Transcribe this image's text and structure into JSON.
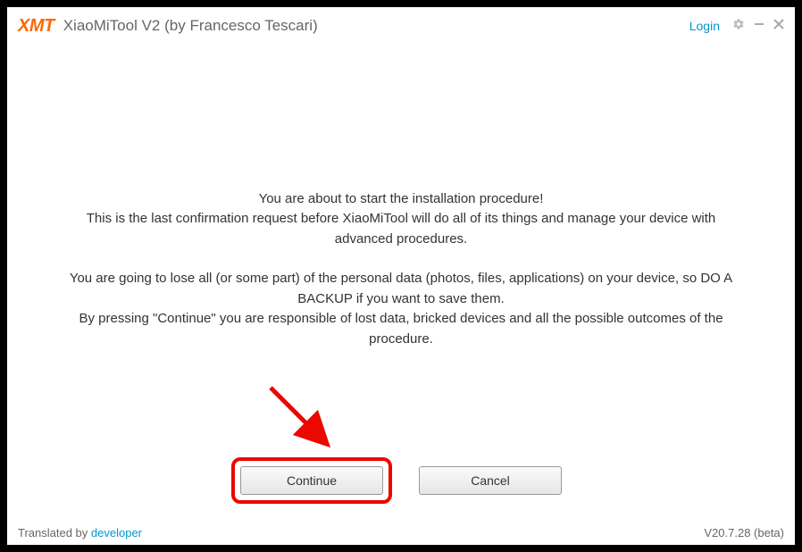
{
  "header": {
    "logo": "XMT",
    "title": "XiaoMiTool V2 (by Francesco Tescari)",
    "login": "Login"
  },
  "message": {
    "line1": "You are about to start the installation procedure!",
    "line2": "This is the last confirmation request before XiaoMiTool will do all of its things and manage your device with advanced procedures.",
    "line3": "You are going to lose all (or some part) of the personal data (photos, files, applications) on your device, so DO A BACKUP if you want to save them.",
    "line4": "By pressing \"Continue\" you are responsible of lost data, bricked devices and all the possible outcomes of the procedure."
  },
  "buttons": {
    "continue": "Continue",
    "cancel": "Cancel"
  },
  "footer": {
    "translated_by": "Translated by ",
    "developer": "developer",
    "version": "V20.7.28 (beta)"
  },
  "annotation": {
    "highlight_color": "#ea0800"
  }
}
